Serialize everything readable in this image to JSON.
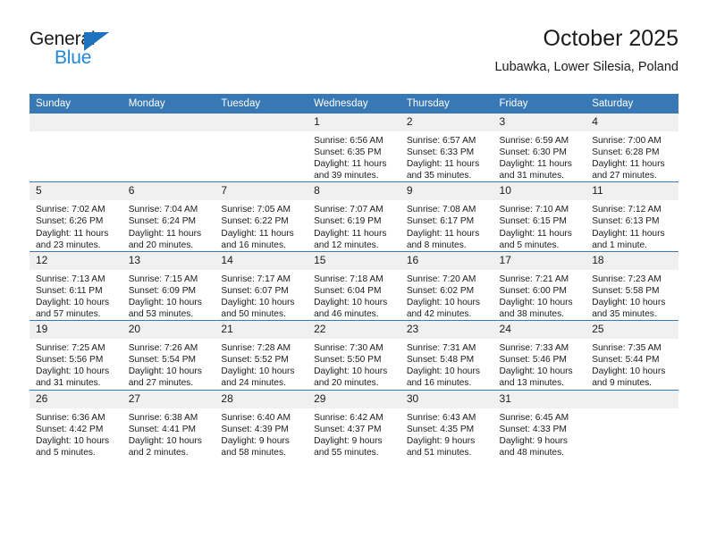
{
  "brand": {
    "name_top": "General",
    "name_bottom": "Blue",
    "accent_color": "#2089d6",
    "triangle_color": "#1e73be"
  },
  "header": {
    "title": "October 2025",
    "subtitle": "Lubawka, Lower Silesia, Poland"
  },
  "theme": {
    "header_row_bg": "#3878b4",
    "header_row_text": "#ffffff",
    "daynum_bg": "#f0f0f0",
    "cell_bg": "#ffffff",
    "text": "#1b1b1b"
  },
  "weekday_headers": [
    "Sunday",
    "Monday",
    "Tuesday",
    "Wednesday",
    "Thursday",
    "Friday",
    "Saturday"
  ],
  "labels": {
    "sunrise_prefix": "Sunrise:",
    "sunset_prefix": "Sunset:",
    "daylight_prefix": "Daylight:"
  },
  "weeks": [
    [
      {
        "day": "",
        "sunrise": "",
        "sunset": "",
        "daylight_line1": "",
        "daylight_line2": ""
      },
      {
        "day": "",
        "sunrise": "",
        "sunset": "",
        "daylight_line1": "",
        "daylight_line2": ""
      },
      {
        "day": "",
        "sunrise": "",
        "sunset": "",
        "daylight_line1": "",
        "daylight_line2": ""
      },
      {
        "day": "1",
        "sunrise": "Sunrise: 6:56 AM",
        "sunset": "Sunset: 6:35 PM",
        "daylight_line1": "Daylight: 11 hours",
        "daylight_line2": "and 39 minutes."
      },
      {
        "day": "2",
        "sunrise": "Sunrise: 6:57 AM",
        "sunset": "Sunset: 6:33 PM",
        "daylight_line1": "Daylight: 11 hours",
        "daylight_line2": "and 35 minutes."
      },
      {
        "day": "3",
        "sunrise": "Sunrise: 6:59 AM",
        "sunset": "Sunset: 6:30 PM",
        "daylight_line1": "Daylight: 11 hours",
        "daylight_line2": "and 31 minutes."
      },
      {
        "day": "4",
        "sunrise": "Sunrise: 7:00 AM",
        "sunset": "Sunset: 6:28 PM",
        "daylight_line1": "Daylight: 11 hours",
        "daylight_line2": "and 27 minutes."
      }
    ],
    [
      {
        "day": "5",
        "sunrise": "Sunrise: 7:02 AM",
        "sunset": "Sunset: 6:26 PM",
        "daylight_line1": "Daylight: 11 hours",
        "daylight_line2": "and 23 minutes."
      },
      {
        "day": "6",
        "sunrise": "Sunrise: 7:04 AM",
        "sunset": "Sunset: 6:24 PM",
        "daylight_line1": "Daylight: 11 hours",
        "daylight_line2": "and 20 minutes."
      },
      {
        "day": "7",
        "sunrise": "Sunrise: 7:05 AM",
        "sunset": "Sunset: 6:22 PM",
        "daylight_line1": "Daylight: 11 hours",
        "daylight_line2": "and 16 minutes."
      },
      {
        "day": "8",
        "sunrise": "Sunrise: 7:07 AM",
        "sunset": "Sunset: 6:19 PM",
        "daylight_line1": "Daylight: 11 hours",
        "daylight_line2": "and 12 minutes."
      },
      {
        "day": "9",
        "sunrise": "Sunrise: 7:08 AM",
        "sunset": "Sunset: 6:17 PM",
        "daylight_line1": "Daylight: 11 hours",
        "daylight_line2": "and 8 minutes."
      },
      {
        "day": "10",
        "sunrise": "Sunrise: 7:10 AM",
        "sunset": "Sunset: 6:15 PM",
        "daylight_line1": "Daylight: 11 hours",
        "daylight_line2": "and 5 minutes."
      },
      {
        "day": "11",
        "sunrise": "Sunrise: 7:12 AM",
        "sunset": "Sunset: 6:13 PM",
        "daylight_line1": "Daylight: 11 hours",
        "daylight_line2": "and 1 minute."
      }
    ],
    [
      {
        "day": "12",
        "sunrise": "Sunrise: 7:13 AM",
        "sunset": "Sunset: 6:11 PM",
        "daylight_line1": "Daylight: 10 hours",
        "daylight_line2": "and 57 minutes."
      },
      {
        "day": "13",
        "sunrise": "Sunrise: 7:15 AM",
        "sunset": "Sunset: 6:09 PM",
        "daylight_line1": "Daylight: 10 hours",
        "daylight_line2": "and 53 minutes."
      },
      {
        "day": "14",
        "sunrise": "Sunrise: 7:17 AM",
        "sunset": "Sunset: 6:07 PM",
        "daylight_line1": "Daylight: 10 hours",
        "daylight_line2": "and 50 minutes."
      },
      {
        "day": "15",
        "sunrise": "Sunrise: 7:18 AM",
        "sunset": "Sunset: 6:04 PM",
        "daylight_line1": "Daylight: 10 hours",
        "daylight_line2": "and 46 minutes."
      },
      {
        "day": "16",
        "sunrise": "Sunrise: 7:20 AM",
        "sunset": "Sunset: 6:02 PM",
        "daylight_line1": "Daylight: 10 hours",
        "daylight_line2": "and 42 minutes."
      },
      {
        "day": "17",
        "sunrise": "Sunrise: 7:21 AM",
        "sunset": "Sunset: 6:00 PM",
        "daylight_line1": "Daylight: 10 hours",
        "daylight_line2": "and 38 minutes."
      },
      {
        "day": "18",
        "sunrise": "Sunrise: 7:23 AM",
        "sunset": "Sunset: 5:58 PM",
        "daylight_line1": "Daylight: 10 hours",
        "daylight_line2": "and 35 minutes."
      }
    ],
    [
      {
        "day": "19",
        "sunrise": "Sunrise: 7:25 AM",
        "sunset": "Sunset: 5:56 PM",
        "daylight_line1": "Daylight: 10 hours",
        "daylight_line2": "and 31 minutes."
      },
      {
        "day": "20",
        "sunrise": "Sunrise: 7:26 AM",
        "sunset": "Sunset: 5:54 PM",
        "daylight_line1": "Daylight: 10 hours",
        "daylight_line2": "and 27 minutes."
      },
      {
        "day": "21",
        "sunrise": "Sunrise: 7:28 AM",
        "sunset": "Sunset: 5:52 PM",
        "daylight_line1": "Daylight: 10 hours",
        "daylight_line2": "and 24 minutes."
      },
      {
        "day": "22",
        "sunrise": "Sunrise: 7:30 AM",
        "sunset": "Sunset: 5:50 PM",
        "daylight_line1": "Daylight: 10 hours",
        "daylight_line2": "and 20 minutes."
      },
      {
        "day": "23",
        "sunrise": "Sunrise: 7:31 AM",
        "sunset": "Sunset: 5:48 PM",
        "daylight_line1": "Daylight: 10 hours",
        "daylight_line2": "and 16 minutes."
      },
      {
        "day": "24",
        "sunrise": "Sunrise: 7:33 AM",
        "sunset": "Sunset: 5:46 PM",
        "daylight_line1": "Daylight: 10 hours",
        "daylight_line2": "and 13 minutes."
      },
      {
        "day": "25",
        "sunrise": "Sunrise: 7:35 AM",
        "sunset": "Sunset: 5:44 PM",
        "daylight_line1": "Daylight: 10 hours",
        "daylight_line2": "and 9 minutes."
      }
    ],
    [
      {
        "day": "26",
        "sunrise": "Sunrise: 6:36 AM",
        "sunset": "Sunset: 4:42 PM",
        "daylight_line1": "Daylight: 10 hours",
        "daylight_line2": "and 5 minutes."
      },
      {
        "day": "27",
        "sunrise": "Sunrise: 6:38 AM",
        "sunset": "Sunset: 4:41 PM",
        "daylight_line1": "Daylight: 10 hours",
        "daylight_line2": "and 2 minutes."
      },
      {
        "day": "28",
        "sunrise": "Sunrise: 6:40 AM",
        "sunset": "Sunset: 4:39 PM",
        "daylight_line1": "Daylight: 9 hours",
        "daylight_line2": "and 58 minutes."
      },
      {
        "day": "29",
        "sunrise": "Sunrise: 6:42 AM",
        "sunset": "Sunset: 4:37 PM",
        "daylight_line1": "Daylight: 9 hours",
        "daylight_line2": "and 55 minutes."
      },
      {
        "day": "30",
        "sunrise": "Sunrise: 6:43 AM",
        "sunset": "Sunset: 4:35 PM",
        "daylight_line1": "Daylight: 9 hours",
        "daylight_line2": "and 51 minutes."
      },
      {
        "day": "31",
        "sunrise": "Sunrise: 6:45 AM",
        "sunset": "Sunset: 4:33 PM",
        "daylight_line1": "Daylight: 9 hours",
        "daylight_line2": "and 48 minutes."
      },
      {
        "day": "",
        "sunrise": "",
        "sunset": "",
        "daylight_line1": "",
        "daylight_line2": ""
      }
    ]
  ]
}
